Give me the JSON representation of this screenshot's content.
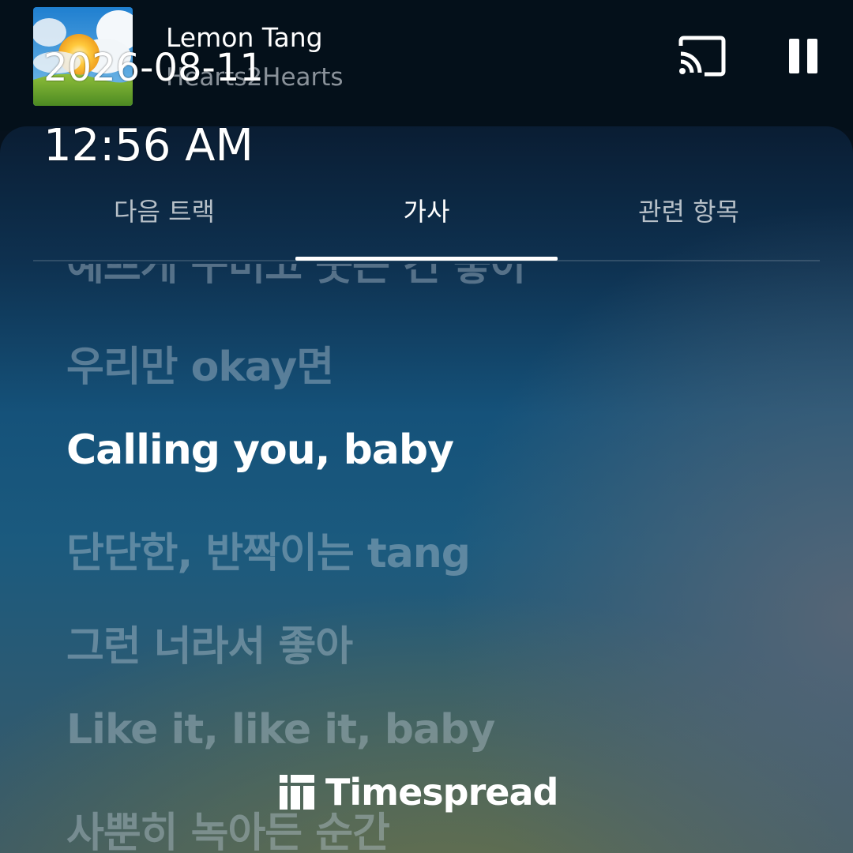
{
  "now_playing": {
    "title": "Lemon Tang",
    "artist": "Hearts2Hearts",
    "album_art_icon": "sunny-sky-album-art",
    "cast_icon": "cast-icon",
    "pause_icon": "pause-icon"
  },
  "tabs": [
    {
      "label": "다음 트랙",
      "selected": false
    },
    {
      "label": "가사",
      "selected": true
    },
    {
      "label": "관련 항목",
      "selected": false
    }
  ],
  "lyrics": {
    "lines": [
      {
        "text": "예쁘게 꾸미고 웃는 건 좋아",
        "current": false
      },
      {
        "text": "우리만 okay면",
        "current": false
      },
      {
        "text": "Calling you, baby",
        "current": true
      },
      {
        "text": "단단한, 반짝이는 tang",
        "current": false
      },
      {
        "text": "그런 너라서 좋아",
        "current": false
      },
      {
        "text": "Like it, like it, baby",
        "current": false
      },
      {
        "text": "사뿐히 녹아든 순간",
        "current": false
      }
    ]
  },
  "overlay": {
    "date": "2026-08-11",
    "time": "12:56 AM",
    "watermark": "Timespread",
    "watermark_icon": "timespread-logo-icon"
  },
  "colors": {
    "header_bg": "#04101a",
    "active_text": "#ffffff",
    "inactive_tab": "#b7c0c8",
    "dim_lyric": "rgba(186,200,212,0.42)"
  }
}
